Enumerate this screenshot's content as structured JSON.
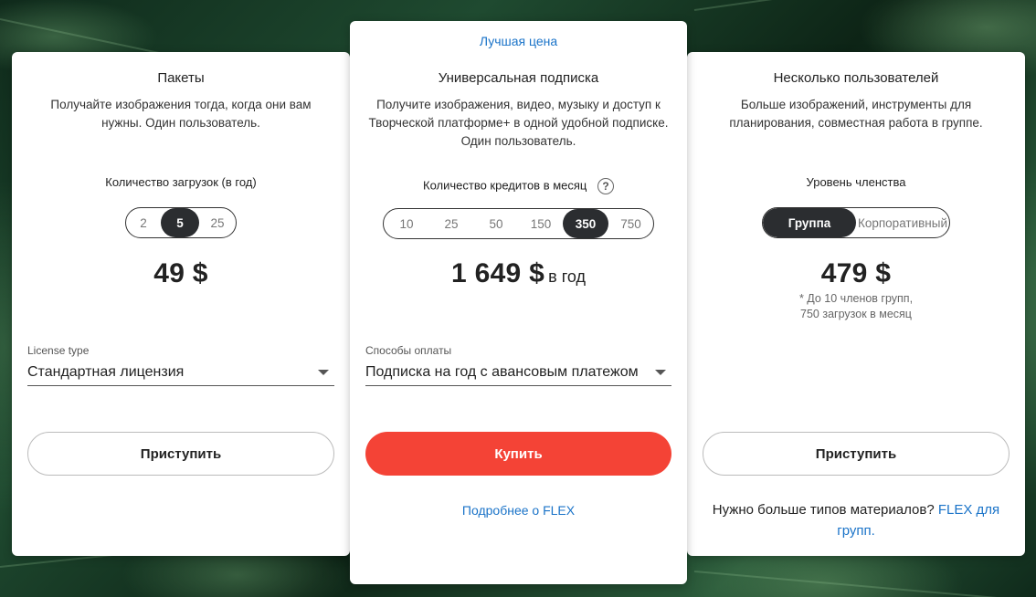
{
  "colors": {
    "accent_blue": "#1a73c8",
    "buy_red": "#f44336",
    "active_dark": "#2b2d30"
  },
  "packs": {
    "title": "Пакеты",
    "description": "Получайте изображения тогда, когда они вам нужны. Один пользователь.",
    "downloads_label": "Количество загрузок (в год)",
    "options": [
      "2",
      "5",
      "25"
    ],
    "selected": "5",
    "price": "49 $",
    "license_field_label": "License type",
    "license_value": "Стандартная лицензия",
    "button": "Приступить"
  },
  "universal": {
    "badge": "Лучшая цена",
    "title": "Универсальная подписка",
    "description": "Получите изображения, видео, музыку и доступ к Творческой платформе+ в одной удобной подписке. Один пользователь.",
    "credits_label": "Количество кредитов в месяц",
    "help_icon": "question-circle-icon",
    "options": [
      "10",
      "25",
      "50",
      "150",
      "350",
      "750"
    ],
    "selected": "350",
    "price": "1 649 $",
    "price_suffix": "в год",
    "payment_field_label": "Способы оплаты",
    "payment_value": "Подписка на год с авансовым платежом",
    "button": "Купить",
    "more_link": "Подробнее о FLEX"
  },
  "multi": {
    "title": "Несколько пользователей",
    "description": "Больше изображений, инструменты для планирования, совместная работа в группе.",
    "membership_label": "Уровень членства",
    "options": [
      "Группа",
      "Корпоративный"
    ],
    "selected": "Группа",
    "price": "479 $",
    "note_line1": "* До 10 членов групп,",
    "note_line2": "750 загрузок в месяц",
    "button": "Приступить",
    "footer_text": "Нужно больше типов материалов?",
    "footer_link": "FLEX для групп."
  }
}
